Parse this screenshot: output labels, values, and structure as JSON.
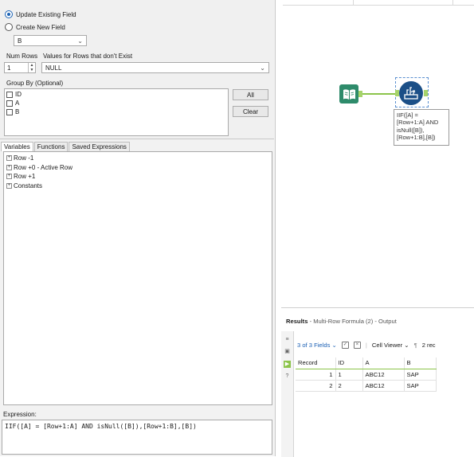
{
  "config": {
    "update_existing_label": "Update Existing Field",
    "create_new_label": "Create New  Field",
    "field_select_value": "B",
    "num_rows_label": "Num Rows",
    "values_label": "Values for Rows that don't Exist",
    "num_rows_value": "1",
    "values_select_value": "NULL",
    "group_by_label": "Group By (Optional)",
    "group_by_items": [
      "ID",
      "A",
      "B"
    ],
    "all_button": "All",
    "clear_button": "Clear"
  },
  "tabs": [
    "Variables",
    "Functions",
    "Saved Expressions"
  ],
  "variables_tree": [
    "Row -1",
    "Row +0 - Active Row",
    "Row +1",
    "Constants"
  ],
  "expression": {
    "label": "Expression:",
    "value": "IIF([A] = [Row+1:A] AND isNull([B]),[Row+1:B],[B])"
  },
  "canvas": {
    "annotation_lines": [
      "IIF([A] =",
      "[Row+1:A] AND",
      "isNull([B]),",
      "[Row+1:B],[B])"
    ]
  },
  "results": {
    "title": "Results",
    "subtitle": "- Multi-Row Formula (2) - Output",
    "fields_label": "3 of 3 Fields",
    "cell_viewer_label": "Cell Viewer",
    "records_label": "2 rec",
    "columns": [
      "Record",
      "ID",
      "A",
      "B"
    ],
    "rows": [
      [
        "1",
        "1",
        "ABC12",
        "SAP"
      ],
      [
        "2",
        "2",
        "ABC12",
        "SAP"
      ]
    ]
  },
  "colors": {
    "accent": "#1a62b5",
    "connector": "#8cc44a",
    "input_tool": "#2e8b6b",
    "multirow_tool": "#1b4f87"
  },
  "icons": [
    "expand-plus-icon",
    "book-input-icon",
    "multi-row-formula-icon",
    "chevron-down-icon"
  ]
}
